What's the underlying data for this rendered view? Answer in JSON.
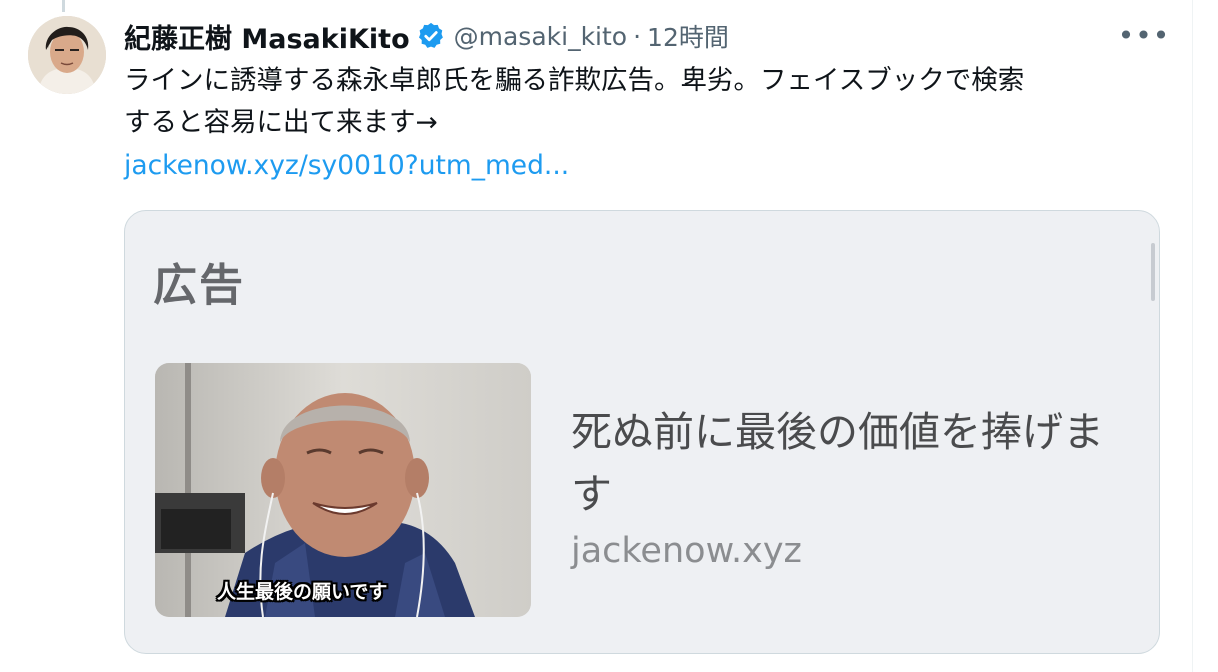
{
  "tweet": {
    "display_name": "紀藤正樹 MasakiKito",
    "verified_icon": "verified-badge-icon",
    "handle": "@masaki_kito",
    "separator": "·",
    "time": "12時間",
    "more_icon": "more-icon",
    "more_label": "•••",
    "text_line1": "ラインに誘導する森永卓郎氏を騙る詐欺広告。卑劣。フェイスブックで検索",
    "text_line2": "すると容易に出て来ます→",
    "link": "jackenow.xyz/sy0010?utm_med..."
  },
  "card": {
    "ad_label": "広告",
    "image_caption": "人生最後の願いです",
    "title": "死ぬ前に最後の価値を捧げます",
    "domain": "jackenow.xyz"
  },
  "colors": {
    "accent": "#1d9bf0",
    "secondary_text": "#536471",
    "card_background": "#eef0f3",
    "border": "#cfd9de"
  }
}
